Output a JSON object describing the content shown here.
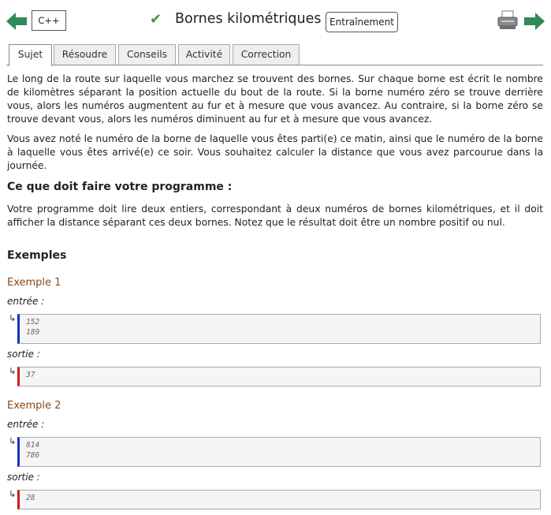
{
  "header": {
    "language": "C++",
    "title": "Bornes kilométriques",
    "mode": "Entraînement",
    "check_glyph": "✔"
  },
  "tabs": [
    "Sujet",
    "Résoudre",
    "Conseils",
    "Activité",
    "Correction"
  ],
  "statement": {
    "p1": "Le long de la route sur laquelle vous marchez se trouvent des bornes. Sur chaque borne est écrit le nombre de kilomètres séparant la position actuelle du bout de la route. Si la borne numéro zéro se trouve derrière vous, alors les numéros augmentent au fur et à mesure que vous avancez. Au contraire, si la borne zéro se trouve devant vous, alors les numéros diminuent au fur et à mesure que vous avancez.",
    "p2": "Vous avez noté le numéro de la borne de laquelle vous êtes parti(e) ce matin, ainsi que le numéro de la borne à laquelle vous êtes arrivé(e) ce soir. Vous souhaitez calculer la distance que vous avez parcourue dans la journée.",
    "task_heading": "Ce que doit faire votre programme :",
    "task": "Votre programme doit lire deux entiers, correspondant à deux numéros de bornes kilométriques, et il doit afficher la distance séparant ces deux bornes. Notez que le résultat doit être un nombre positif ou nul.",
    "examples_heading": "Exemples"
  },
  "examples": [
    {
      "title": "Exemple 1",
      "input_label": "entrée :",
      "input_lines": [
        "152",
        "189"
      ],
      "output_label": "sortie :",
      "output_lines": [
        "37"
      ]
    },
    {
      "title": "Exemple 2",
      "input_label": "entrée :",
      "input_lines": [
        "814",
        "786"
      ],
      "output_label": "sortie :",
      "output_lines": [
        "28"
      ]
    }
  ],
  "io_arrow": "↳",
  "colors": {
    "accent_green": "#3a9a3a",
    "arrow_green": "#2e8b57",
    "example_title": "#8b4a0f",
    "input_bar": "#1a2fbf",
    "output_bar": "#d11a1a"
  }
}
